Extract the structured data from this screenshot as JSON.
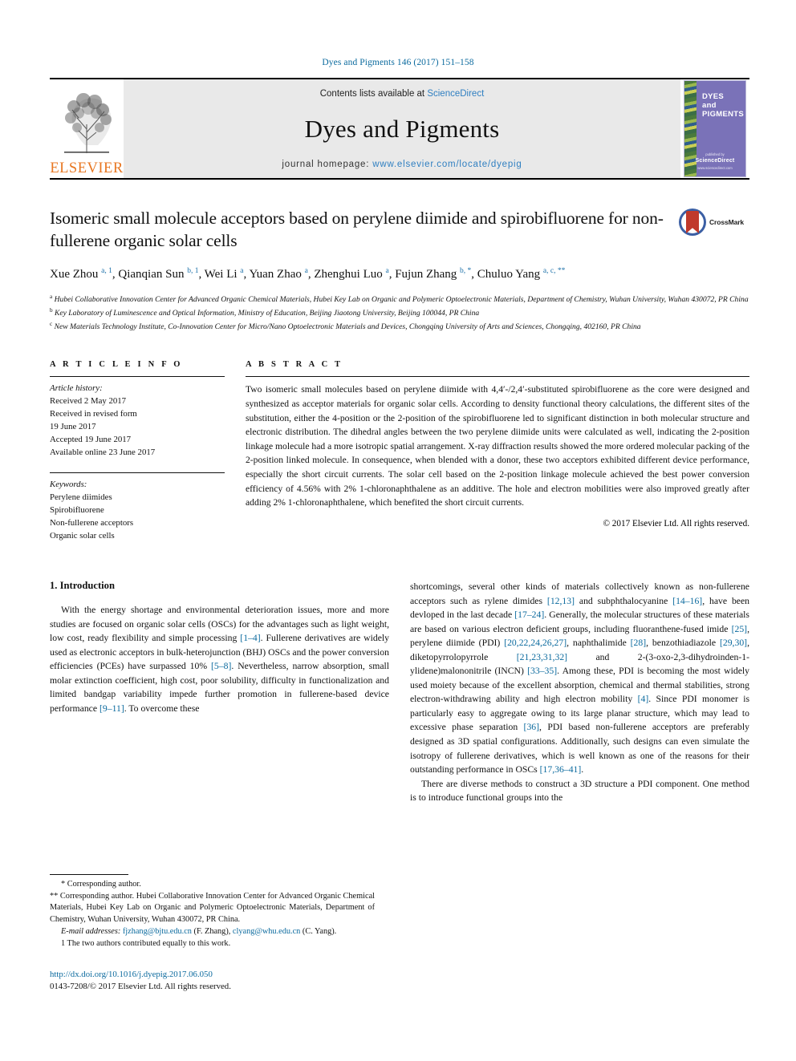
{
  "running_head": "Dyes and Pigments 146 (2017) 151–158",
  "masthead": {
    "publisher": "ELSEVIER",
    "contents_prefix": "Contents lists available at ",
    "contents_link": "ScienceDirect",
    "journal_title": "Dyes and Pigments",
    "homepage_prefix": "journal homepage: ",
    "homepage_url": "www.elsevier.com/locate/dyepig",
    "cover_title": "DYES and PIGMENTS",
    "cover_foot_pre": "published by",
    "cover_foot_logo": "ScienceDirect",
    "cover_foot_url": "www.sciencedirect.com",
    "accent_blue": "#2f7fc1",
    "elsevier_orange": "#e87722",
    "cover_purple": "#7a72b8"
  },
  "article": {
    "title": "Isomeric small molecule acceptors based on perylene diimide and spirobifluorene for non-fullerene organic solar cells",
    "crossmark_label": "CrossMark",
    "authors_html": "Xue Zhou <sup>a, 1</sup>, Qianqian Sun <sup>b, 1</sup>, Wei Li <sup>a</sup>, Yuan Zhao <sup>a</sup>, Zhenghui Luo <sup>a</sup>, Fujun Zhang <sup>b, *</sup>, Chuluo Yang <sup>a, c, **</sup>",
    "affiliations": [
      "a Hubei Collaborative Innovation Center for Advanced Organic Chemical Materials, Hubei Key Lab on Organic and Polymeric Optoelectronic Materials, Department of Chemistry, Wuhan University, Wuhan 430072, PR China",
      "b Key Laboratory of Luminescence and Optical Information, Ministry of Education, Beijing Jiaotong University, Beijing 100044, PR China",
      "c New Materials Technology Institute, Co-Innovation Center for Micro/Nano Optoelectronic Materials and Devices, Chongqing University of Arts and Sciences, Chongqing, 402160, PR China"
    ]
  },
  "article_info": {
    "heading": "A R T I C L E   I N F O",
    "history_label": "Article history:",
    "history": [
      "Received 2 May 2017",
      "Received in revised form",
      "19 June 2017",
      "Accepted 19 June 2017",
      "Available online 23 June 2017"
    ],
    "keywords_label": "Keywords:",
    "keywords": [
      "Perylene diimides",
      "Spirobifluorene",
      "Non-fullerene acceptors",
      "Organic solar cells"
    ]
  },
  "abstract": {
    "heading": "A B S T R A C T",
    "text": "Two isomeric small molecules based on perylene diimide with 4,4′-/2,4′-substituted spirobifluorene as the core were designed and synthesized as acceptor materials for organic solar cells. According to density functional theory calculations, the different sites of the substitution, either the 4-position or the 2-position of the spirobifluorene led to significant distinction in both molecular structure and electronic distribution. The dihedral angles between the two perylene diimide units were calculated as well, indicating the 2-position linkage molecule had a more isotropic spatial arrangement. X-ray diffraction results showed the more ordered molecular packing of the 2-position linked molecule. In consequence, when blended with a donor, these two acceptors exhibited different device performance, especially the short circuit currents. The solar cell based on the 2-position linkage molecule achieved the best power conversion efficiency of 4.56% with 2% 1-chloronaphthalene as an additive. The hole and electron mobilities were also improved greatly after adding 2% 1-chloronaphthalene, which benefited the short circuit currents.",
    "copyright": "© 2017 Elsevier Ltd. All rights reserved."
  },
  "introduction": {
    "heading": "1.  Introduction",
    "left_paragraph_html": "With the energy shortage and environmental deterioration issues, more and more studies are focused on organic solar cells (OSCs) for the advantages such as light weight, low cost, ready flexibility and simple processing <span class=\"ref\">[1–4]</span>. Fullerene derivatives are widely used as electronic acceptors in bulk-heterojunction (BHJ) OSCs and the power conversion efficiencies (PCEs) have surpassed 10% <span class=\"ref\">[5–8]</span>. Nevertheless, narrow absorption, small molar extinction coefficient, high cost, poor solubility, difficulty in functionalization and limited bandgap variability impede further promotion in fullerene-based device performance <span class=\"ref\">[9–11]</span>. To overcome these",
    "right_paragraph_1_html": "shortcomings, several other kinds of materials collectively known as non-fullerene acceptors such as rylene dimides <span class=\"ref\">[12,13]</span> and subphthalocyanine <span class=\"ref\">[14–16]</span>, have been devloped in the last decade <span class=\"ref\">[17–24]</span>. Generally, the molecular structures of these materials are based on various electron deficient groups, including fluoranthene-fused imide <span class=\"ref\">[25]</span>, perylene diimide (PDI) <span class=\"ref\">[20,22,24,26,27]</span>, naphthalimide <span class=\"ref\">[28]</span>, benzothiadiazole <span class=\"ref\">[29,30]</span>, diketopyrrolopyrrole <span class=\"ref\">[21,23,31,32]</span> and 2-(3-oxo-2,3-dihydroinden-1- ylidene)malononitrile (INCN) <span class=\"ref\">[33–35]</span>. Among these, PDI is becoming the most widely used moiety because of the excellent absorption, chemical and thermal stabilities, strong electron-withdrawing ability and high electron mobility <span class=\"ref\">[4]</span>. Since PDI monomer is particularly easy to aggregate owing to its large planar structure, which may lead to excessive phase separation <span class=\"ref\">[36]</span>, PDI based non-fullerene acceptors are preferably designed as 3D spatial configurations. Additionally, such designs can even simulate the isotropy of fullerene derivatives, which is well known as one of the reasons for their outstanding performance in OSCs <span class=\"ref\">[17,36–41]</span>.",
    "right_paragraph_2_html": "There are diverse methods to construct a 3D structure a PDI component. One method is to introduce functional groups into the"
  },
  "footnotes": {
    "corresponding_1": "* Corresponding author.",
    "corresponding_2": "** Corresponding author. Hubei Collaborative Innovation Center for Advanced Organic Chemical Materials, Hubei Key Lab on Organic and Polymeric Optoelectronic Materials, Department of Chemistry, Wuhan University, Wuhan 430072, PR China.",
    "email_label": "E-mail addresses:",
    "email_1": "fjzhang@bjtu.edu.cn",
    "email_1_name": "(F. Zhang)",
    "email_2": "clyang@whu.edu.cn",
    "email_2_name": "(C. Yang).",
    "equal_contribution": "1  The two authors contributed equally to this work."
  },
  "bottom": {
    "doi": "http://dx.doi.org/10.1016/j.dyepig.2017.06.050",
    "issn_line": "0143-7208/© 2017 Elsevier Ltd. All rights reserved."
  }
}
